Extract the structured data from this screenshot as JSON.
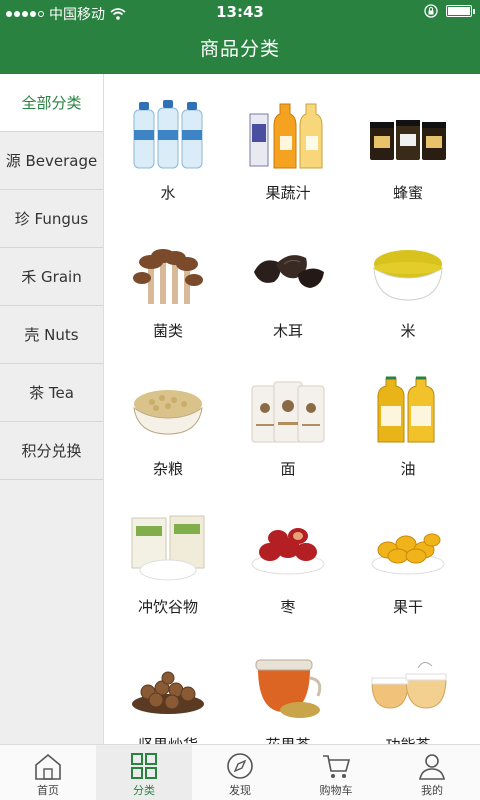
{
  "status": {
    "carrier": "中国移动",
    "time": "13:43"
  },
  "header": {
    "title": "商品分类"
  },
  "sidebar": {
    "items": [
      {
        "label": "全部分类",
        "active": true
      },
      {
        "label": "源 Beverage"
      },
      {
        "label": "珍 Fungus"
      },
      {
        "label": "禾 Grain"
      },
      {
        "label": "壳 Nuts"
      },
      {
        "label": "茶 Tea"
      },
      {
        "label": "积分兑换"
      }
    ]
  },
  "categories": [
    {
      "label": "水",
      "icon": "water-bottles-icon"
    },
    {
      "label": "果蔬汁",
      "icon": "juice-bottles-icon"
    },
    {
      "label": "蜂蜜",
      "icon": "honey-jars-icon"
    },
    {
      "label": "菌类",
      "icon": "mushroom-icon"
    },
    {
      "label": "木耳",
      "icon": "black-fungus-icon"
    },
    {
      "label": "米",
      "icon": "millet-bowl-icon"
    },
    {
      "label": "杂粮",
      "icon": "soybeans-bowl-icon"
    },
    {
      "label": "面",
      "icon": "flour-bags-icon"
    },
    {
      "label": "油",
      "icon": "oil-bottles-icon"
    },
    {
      "label": "冲饮谷物",
      "icon": "cereal-powder-icon"
    },
    {
      "label": "枣",
      "icon": "jujube-plate-icon"
    },
    {
      "label": "果干",
      "icon": "dried-fruit-plate-icon"
    },
    {
      "label": "坚果炒货",
      "icon": "hazelnut-plate-icon"
    },
    {
      "label": "花果茶",
      "icon": "flower-tea-icon"
    },
    {
      "label": "功能茶",
      "icon": "functional-tea-icon"
    }
  ],
  "tabbar": {
    "items": [
      {
        "label": "首页",
        "icon": "home-icon"
      },
      {
        "label": "分类",
        "icon": "category-grid-icon",
        "active": true
      },
      {
        "label": "发现",
        "icon": "compass-icon"
      },
      {
        "label": "购物车",
        "icon": "cart-icon"
      },
      {
        "label": "我的",
        "icon": "user-icon"
      }
    ]
  },
  "colors": {
    "brand": "#2a8240",
    "sidebar_bg": "#eeeeee"
  }
}
